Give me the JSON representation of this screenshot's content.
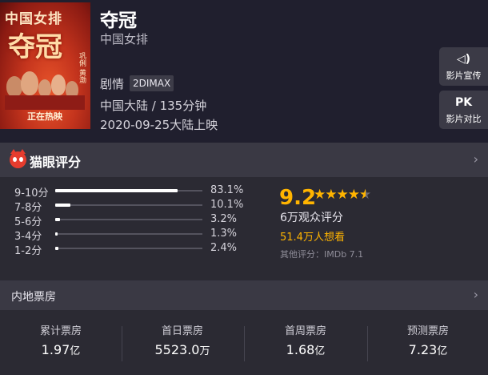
{
  "movie": {
    "title": "夺冠",
    "subtitle": "中国女排",
    "genre": "剧情",
    "format_tag": "2DIMAX",
    "region_duration": "中国大陆 / 135分钟",
    "release": "2020-09-25大陆上映",
    "poster": {
      "top_text": "中国女排",
      "big_text": "夺冠",
      "side_text": "巩俐 黄渤",
      "bottom_text": "正在热映"
    }
  },
  "side_buttons": [
    {
      "label": "影片宣传",
      "icon": "speaker-icon",
      "icon_text": "◁)"
    },
    {
      "label": "影片对比",
      "icon": "pk-icon",
      "icon_text": "PK"
    }
  ],
  "rating": {
    "header": "猫眼评分",
    "distribution": [
      {
        "label": "9-10分",
        "percent_text": "83.1%",
        "fraction": 0.831
      },
      {
        "label": "7-8分",
        "percent_text": "10.1%",
        "fraction": 0.101
      },
      {
        "label": "5-6分",
        "percent_text": "3.2%",
        "fraction": 0.032
      },
      {
        "label": "3-4分",
        "percent_text": "1.3%",
        "fraction": 0.013
      },
      {
        "label": "1-2分",
        "percent_text": "2.4%",
        "fraction": 0.024
      }
    ],
    "score": "9.2",
    "stars": 4.5,
    "viewers": "6万观众评分",
    "wants": "51.4万人想看",
    "other": "其他评分：IMDb 7.1"
  },
  "box_office": {
    "header": "内地票房",
    "items": [
      {
        "label": "累计票房",
        "value": "1.97",
        "unit": "亿"
      },
      {
        "label": "首日票房",
        "value": "5523.0",
        "unit": "万"
      },
      {
        "label": "首周票房",
        "value": "1.68",
        "unit": "亿"
      },
      {
        "label": "预测票房",
        "value": "7.23",
        "unit": "亿"
      }
    ]
  },
  "colors": {
    "accent": "#ffb400",
    "header_bg": "#201f2e",
    "section_bg": "#3a3944",
    "body_bg": "#2b2a33",
    "logo_red": "#e63c2e"
  }
}
